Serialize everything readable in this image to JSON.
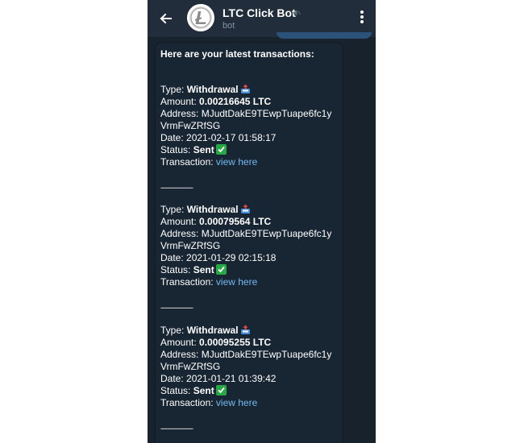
{
  "header": {
    "title": "LTC Click Bot",
    "subtitle": "bot"
  },
  "message": {
    "intro": "Here are your latest transactions:",
    "separator": "--------------------",
    "labels": {
      "type": "Type: ",
      "amount": "Amount: ",
      "address": "Address: ",
      "date": "Date: ",
      "status": "Status: ",
      "transaction": "Transaction: "
    },
    "transactions": [
      {
        "type": "Withdrawal",
        "amount": "0.00216645 LTC",
        "address_line1": "MJudtDakE9TEwpTuape6fc1y",
        "address_line2": "VrmFwZRfSG",
        "date": "2021-02-17 01:58:17",
        "status": "Sent",
        "link": "view here"
      },
      {
        "type": "Withdrawal",
        "amount": "0.00079564 LTC",
        "address_line1": "MJudtDakE9TEwpTuape6fc1y",
        "address_line2": "VrmFwZRfSG",
        "date": "2021-01-29 02:15:18",
        "status": "Sent",
        "link": "view here"
      },
      {
        "type": "Withdrawal",
        "amount": "0.00095255 LTC",
        "address_line1": "MJudtDakE9TEwpTuape6fc1y",
        "address_line2": "VrmFwZRfSG",
        "date": "2021-01-21 01:39:42",
        "status": "Sent",
        "link": "view here"
      }
    ]
  },
  "icons": {
    "back": "back-arrow-icon",
    "menu": "more-vertical-icon",
    "mute": "muted-icon",
    "withdraw": "outbox-tray-icon",
    "sent": "check-mark-icon"
  },
  "colors": {
    "chat_bg": "#18222d",
    "header_bg": "#212d3b",
    "bubble_bg": "#182533",
    "link": "#71baf2",
    "check_green": "#28a745"
  }
}
